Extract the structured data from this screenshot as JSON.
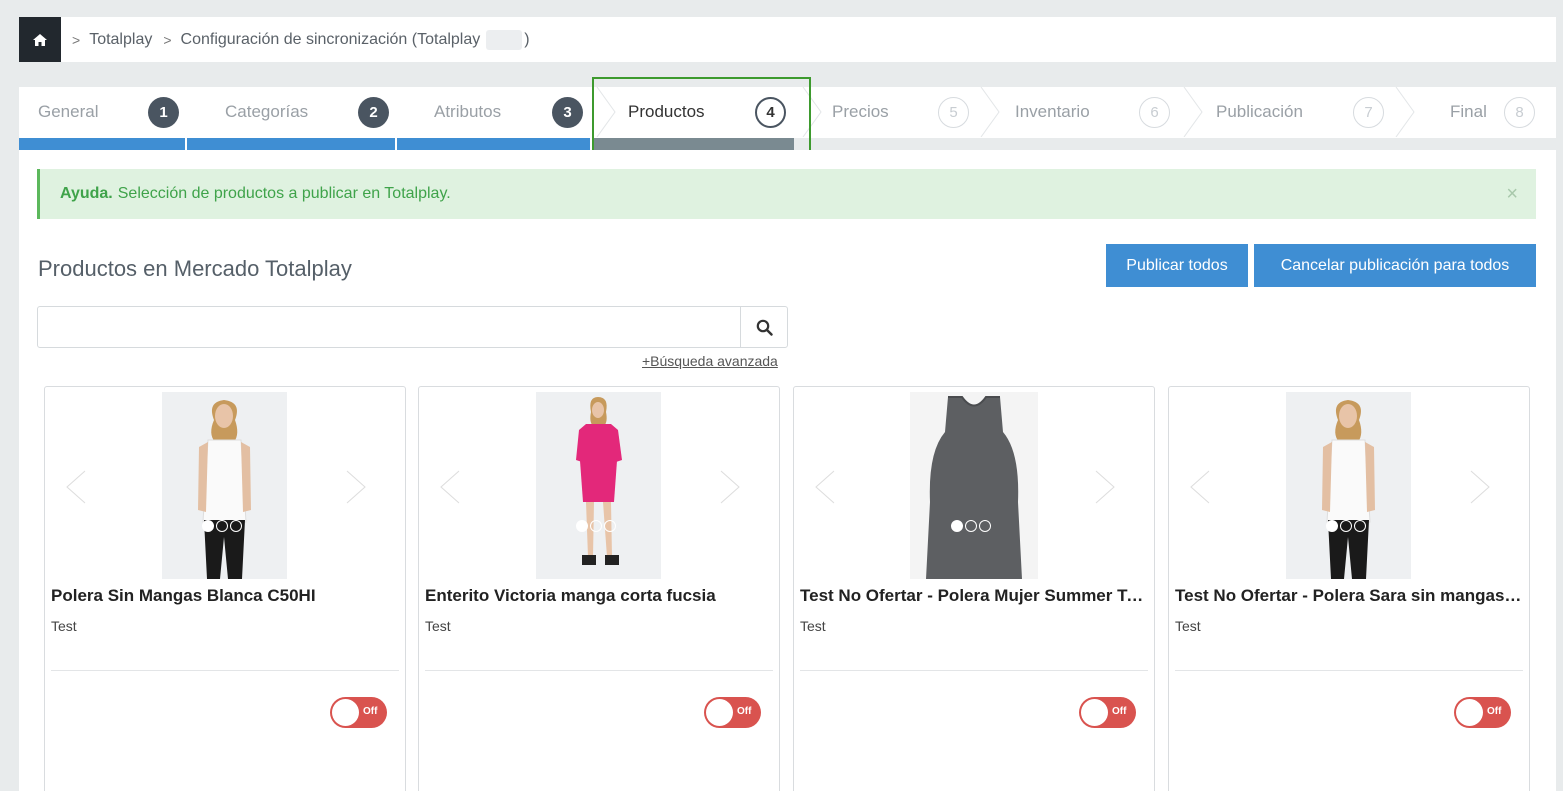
{
  "breadcrumb": {
    "items": [
      "Totalplay",
      "Configuración de sincronización (Totalplay"
    ],
    "suffix": ")"
  },
  "wizard": {
    "steps": [
      {
        "label": "General",
        "num": "1",
        "state": "done"
      },
      {
        "label": "Categorías",
        "num": "2",
        "state": "done"
      },
      {
        "label": "Atributos",
        "num": "3",
        "state": "done"
      },
      {
        "label": "Productos",
        "num": "4",
        "state": "active"
      },
      {
        "label": "Precios",
        "num": "5",
        "state": "todo"
      },
      {
        "label": "Inventario",
        "num": "6",
        "state": "todo"
      },
      {
        "label": "Publicación",
        "num": "7",
        "state": "todo"
      },
      {
        "label": "Final",
        "num": "8",
        "state": "todo"
      }
    ]
  },
  "alert": {
    "title": "Ayuda.",
    "text": "Selección de productos a publicar en Totalplay.",
    "close": "×"
  },
  "section": {
    "title": "Productos en Mercado Totalplay",
    "publish_all": "Publicar todos",
    "cancel_all": "Cancelar publicación para todos"
  },
  "search": {
    "value": "",
    "placeholder": "",
    "advanced": "+Búsqueda avanzada"
  },
  "products": [
    {
      "title": "Polera Sin Mangas Blanca C50HI",
      "subtitle": "Test",
      "toggle": "Off"
    },
    {
      "title": "Enterito Victoria manga corta fucsia",
      "subtitle": "Test",
      "toggle": "Off"
    },
    {
      "title": "Test No Ofertar - Polera Mujer Summer Tank Gris",
      "subtitle": "Test",
      "toggle": "Off"
    },
    {
      "title": "Test No Ofertar - Polera Sara sin mangas blanca",
      "subtitle": "Test",
      "toggle": "Off"
    }
  ],
  "colors": {
    "accent": "#3f8ed3",
    "alert_green": "#3fa34a",
    "toggle_off": "#d9534f",
    "step_done": "#4a5561"
  }
}
